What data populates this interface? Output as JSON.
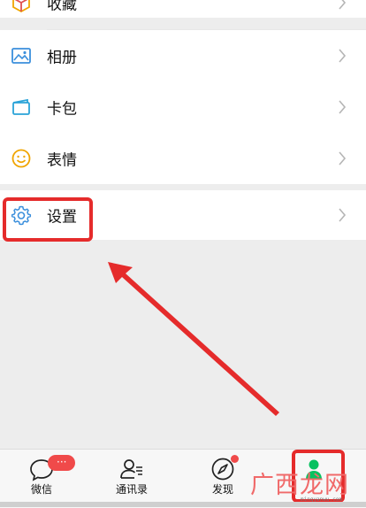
{
  "menu": {
    "items": [
      {
        "label": "收藏",
        "icon": "cube-icon"
      },
      {
        "label": "相册",
        "icon": "image-icon"
      },
      {
        "label": "卡包",
        "icon": "card-icon"
      },
      {
        "label": "表情",
        "icon": "smiley-icon"
      }
    ],
    "settings": {
      "label": "设置",
      "icon": "gear-icon"
    }
  },
  "tabbar": {
    "tabs": [
      {
        "label": "微信",
        "icon": "chat-bubble-icon",
        "badge": "···"
      },
      {
        "label": "通讯录",
        "icon": "contacts-icon"
      },
      {
        "label": "发现",
        "icon": "compass-icon"
      },
      {
        "label": "",
        "icon": "me-person-icon"
      }
    ]
  },
  "watermark": {
    "text": "广西龙网",
    "small": "mingyanwu.com"
  },
  "colors": {
    "highlight": "#e52b2b",
    "wechat_green": "#07c160",
    "badge": "#f04a4a"
  }
}
